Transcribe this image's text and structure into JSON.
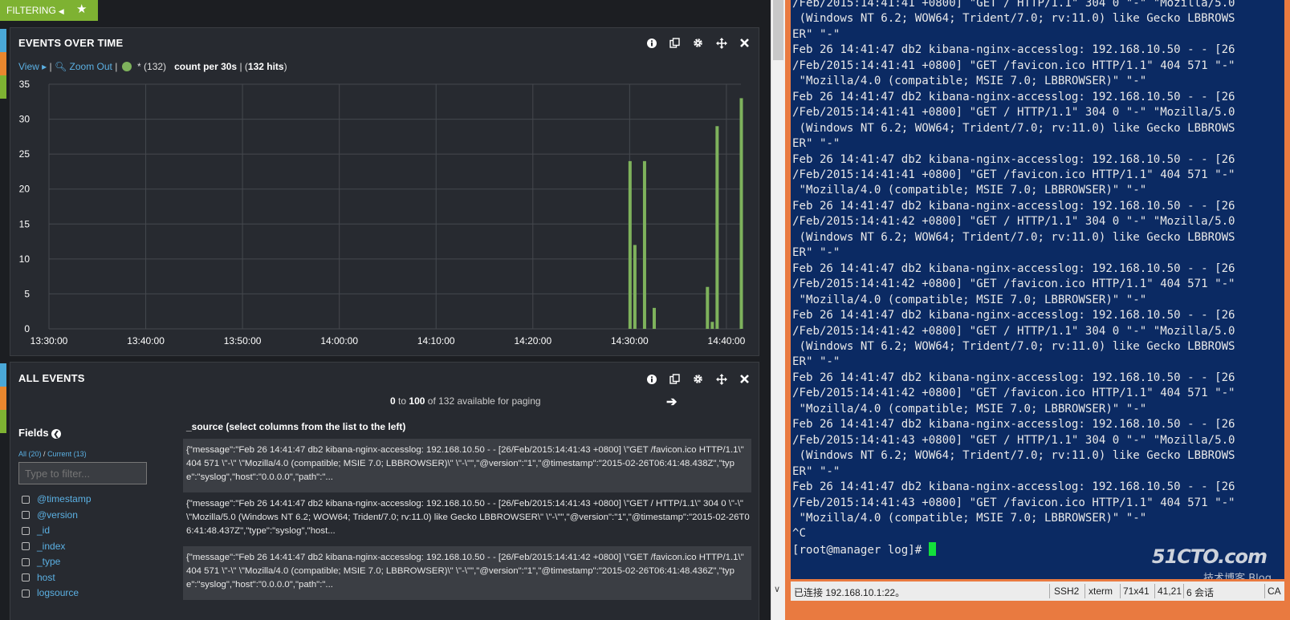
{
  "filter_bar": {
    "label": "FILTERING"
  },
  "events_panel": {
    "title": "EVENTS OVER TIME",
    "view_label": "View",
    "zoom_out_label": "Zoom Out",
    "series_label": "* (132)",
    "count_label": "count per 30s",
    "hits_prefix": "| (",
    "hits_value": "132 hits",
    "hits_suffix": ")"
  },
  "chart_data": {
    "type": "bar",
    "xlabel": "",
    "ylabel": "",
    "ylim": [
      0,
      35
    ],
    "yticks": [
      "0",
      "5",
      "10",
      "15",
      "20",
      "25",
      "30",
      "35"
    ],
    "xticks": [
      "13:30:00",
      "13:40:00",
      "13:50:00",
      "14:00:00",
      "14:10:00",
      "14:20:00",
      "14:30:00",
      "14:40:00"
    ],
    "x_range_minutes": [
      0,
      71.5
    ],
    "grid": true,
    "color": "#7eb25c",
    "series": [
      {
        "bars": [
          {
            "time": "14:30:00",
            "value": 24
          },
          {
            "time": "14:30:30",
            "value": 12
          },
          {
            "time": "14:31:30",
            "value": 24
          },
          {
            "time": "14:32:30",
            "value": 3
          },
          {
            "time": "14:38:00",
            "value": 6
          },
          {
            "time": "14:38:30",
            "value": 1
          },
          {
            "time": "14:39:00",
            "value": 29
          },
          {
            "time": "14:41:30",
            "value": 33
          }
        ]
      }
    ]
  },
  "all_events_panel": {
    "title": "ALL EVENTS",
    "paging_from": "0",
    "paging_to_word": "to",
    "paging_to": "100",
    "paging_suffix": "of 132 available for paging",
    "source_header": "_source (select columns from the list to the left)",
    "fields_title": "Fields",
    "fields_all": "All (20)",
    "fields_sep": "/",
    "fields_current": "Current (13)",
    "filter_placeholder": "Type to filter...",
    "field_names": [
      "@timestamp",
      "@version",
      "_id",
      "_index",
      "_type",
      "host",
      "logsource"
    ],
    "rows": [
      "{\"message\":\"Feb 26 14:41:47 db2 kibana-nginx-accesslog: 192.168.10.50 - - [26/Feb/2015:14:41:43 +0800] \\\"GET /favicon.ico HTTP/1.1\\\" 404 571 \\\"-\\\" \\\"Mozilla/4.0 (compatible; MSIE 7.0; LBBROWSER)\\\" \\\"-\\\"\",\"@version\":\"1\",\"@timestamp\":\"2015-02-26T06:41:48.438Z\",\"type\":\"syslog\",\"host\":\"0.0.0.0\",\"path\":\"...",
      "{\"message\":\"Feb 26 14:41:47 db2 kibana-nginx-accesslog: 192.168.10.50 - - [26/Feb/2015:14:41:43 +0800] \\\"GET / HTTP/1.1\\\" 304 0 \\\"-\\\" \\\"Mozilla/5.0 (Windows NT 6.2; WOW64; Trident/7.0; rv:11.0) like Gecko LBBROWSER\\\" \\\"-\\\"\",\"@version\":\"1\",\"@timestamp\":\"2015-02-26T06:41:48.437Z\",\"type\":\"syslog\",\"host...",
      "{\"message\":\"Feb 26 14:41:47 db2 kibana-nginx-accesslog: 192.168.10.50 - - [26/Feb/2015:14:41:42 +0800] \\\"GET /favicon.ico HTTP/1.1\\\" 404 571 \\\"-\\\" \\\"Mozilla/4.0 (compatible; MSIE 7.0; LBBROWSER)\\\" \\\"-\\\"\",\"@version\":\"1\",\"@timestamp\":\"2015-02-26T06:41:48.436Z\",\"type\":\"syslog\",\"host\":\"0.0.0.0\",\"path\":\"..."
    ]
  },
  "terminal": {
    "lines": [
      "/Feb/2015:14:41:41 +0800] \"GET / HTTP/1.1\" 304 0 \"-\" \"Mozilla/5.0",
      " (Windows NT 6.2; WOW64; Trident/7.0; rv:11.0) like Gecko LBBROWS",
      "ER\" \"-\"",
      "Feb 26 14:41:47 db2 kibana-nginx-accesslog: 192.168.10.50 - - [26",
      "/Feb/2015:14:41:41 +0800] \"GET /favicon.ico HTTP/1.1\" 404 571 \"-\"",
      " \"Mozilla/4.0 (compatible; MSIE 7.0; LBBROWSER)\" \"-\"",
      "Feb 26 14:41:47 db2 kibana-nginx-accesslog: 192.168.10.50 - - [26",
      "/Feb/2015:14:41:41 +0800] \"GET / HTTP/1.1\" 304 0 \"-\" \"Mozilla/5.0",
      " (Windows NT 6.2; WOW64; Trident/7.0; rv:11.0) like Gecko LBBROWS",
      "ER\" \"-\"",
      "Feb 26 14:41:47 db2 kibana-nginx-accesslog: 192.168.10.50 - - [26",
      "/Feb/2015:14:41:41 +0800] \"GET /favicon.ico HTTP/1.1\" 404 571 \"-\"",
      " \"Mozilla/4.0 (compatible; MSIE 7.0; LBBROWSER)\" \"-\"",
      "Feb 26 14:41:47 db2 kibana-nginx-accesslog: 192.168.10.50 - - [26",
      "/Feb/2015:14:41:42 +0800] \"GET / HTTP/1.1\" 304 0 \"-\" \"Mozilla/5.0",
      " (Windows NT 6.2; WOW64; Trident/7.0; rv:11.0) like Gecko LBBROWS",
      "ER\" \"-\"",
      "Feb 26 14:41:47 db2 kibana-nginx-accesslog: 192.168.10.50 - - [26",
      "/Feb/2015:14:41:42 +0800] \"GET /favicon.ico HTTP/1.1\" 404 571 \"-\"",
      " \"Mozilla/4.0 (compatible; MSIE 7.0; LBBROWSER)\" \"-\"",
      "Feb 26 14:41:47 db2 kibana-nginx-accesslog: 192.168.10.50 - - [26",
      "/Feb/2015:14:41:42 +0800] \"GET / HTTP/1.1\" 304 0 \"-\" \"Mozilla/5.0",
      " (Windows NT 6.2; WOW64; Trident/7.0; rv:11.0) like Gecko LBBROWS",
      "ER\" \"-\"",
      "Feb 26 14:41:47 db2 kibana-nginx-accesslog: 192.168.10.50 - - [26",
      "/Feb/2015:14:41:42 +0800] \"GET /favicon.ico HTTP/1.1\" 404 571 \"-\"",
      " \"Mozilla/4.0 (compatible; MSIE 7.0; LBBROWSER)\" \"-\"",
      "Feb 26 14:41:47 db2 kibana-nginx-accesslog: 192.168.10.50 - - [26",
      "/Feb/2015:14:41:43 +0800] \"GET / HTTP/1.1\" 304 0 \"-\" \"Mozilla/5.0",
      " (Windows NT 6.2; WOW64; Trident/7.0; rv:11.0) like Gecko LBBROWS",
      "ER\" \"-\"",
      "Feb 26 14:41:47 db2 kibana-nginx-accesslog: 192.168.10.50 - - [26",
      "/Feb/2015:14:41:43 +0800] \"GET /favicon.ico HTTP/1.1\" 404 571 \"-\"",
      " \"Mozilla/4.0 (compatible; MSIE 7.0; LBBROWSER)\" \"-\"",
      "^C"
    ],
    "prompt": "[root@manager log]# ",
    "status": {
      "connection": "已连接 192.168.10.1:22。",
      "protocol": "SSH2",
      "term": "xterm",
      "size": "71x41",
      "cursor_pos": "41,21",
      "sessions": "6 会话",
      "caps": "CA"
    },
    "watermark": "51CTO.com",
    "watermark_sub": "技术博客  Blog"
  },
  "colors": {
    "accent_green": "#7eb232",
    "bar_green": "#7eb25c",
    "link_blue": "#5bb0e3",
    "terminal_bg": "#0b2a63",
    "terminal_frame": "#e97a40",
    "cursor_green": "#13e03b"
  },
  "icons": {
    "filter_collapse": "caret-left-icon",
    "favorite": "star-icon",
    "panel_info": "info-icon",
    "panel_clone": "clone-icon",
    "panel_settings": "gear-icon",
    "panel_move": "move-icon",
    "panel_close": "close-icon",
    "zoom": "zoom-out-icon",
    "next_page": "arrow-right-icon",
    "fields_toggle": "chevron-left-circle-icon"
  }
}
